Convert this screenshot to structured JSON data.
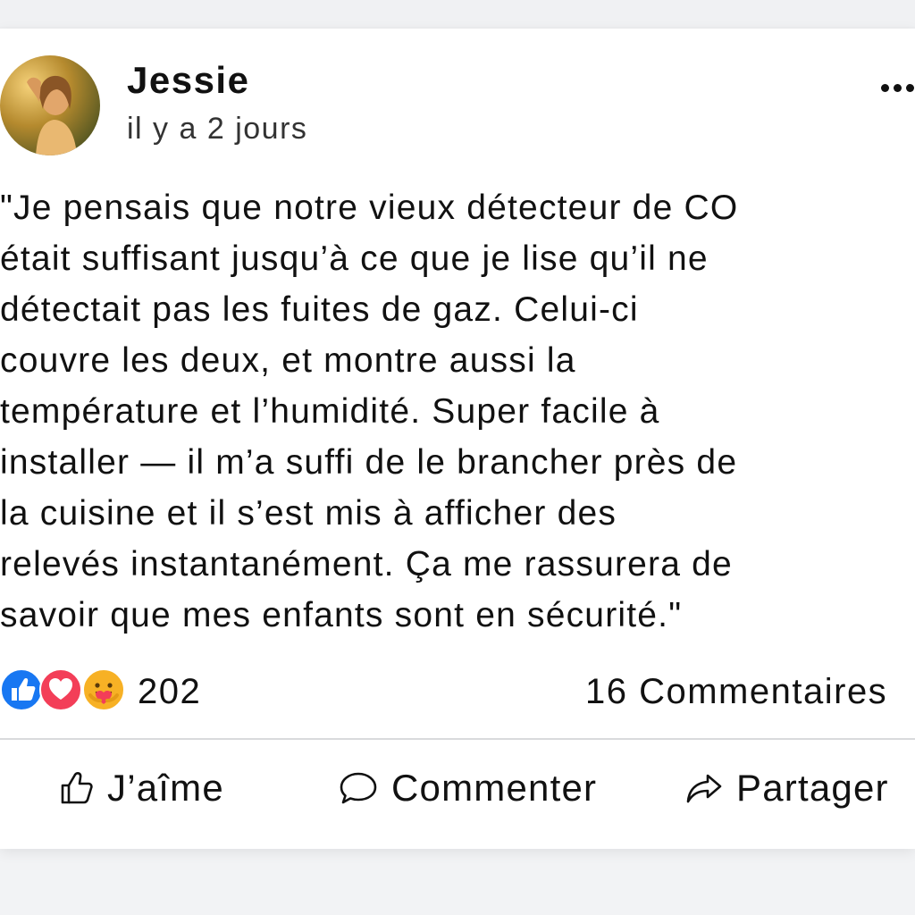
{
  "post": {
    "author": "Jessie",
    "timestamp": "il y a 2 jours",
    "text": "\"Je pensais que notre vieux détecteur de CO\nétait suffisant jusqu’à ce que je lise qu’il ne\ndétectait pas les fuites de gaz. Celui-ci\ncouvre les deux, et montre aussi la\ntempérature et l’humidité. Super facile à\ninstaller — il m’a suffi de le brancher près de\nla cuisine et il s’est mis à afficher des\nrelevés instantanément. Ça me rassurera de\nsavoir que mes enfants sont en sécurité.\""
  },
  "reactions": {
    "icons": [
      "like-reaction-icon",
      "love-reaction-icon",
      "care-reaction-icon"
    ],
    "count": "202",
    "comments": "16 Commentaires"
  },
  "actions": {
    "like": "J’aîme",
    "comment": "Commenter",
    "share": "Partager"
  },
  "colors": {
    "like_blue": "#1877f2",
    "love_red": "#f33e58",
    "care_yellow": "#f7b125"
  }
}
